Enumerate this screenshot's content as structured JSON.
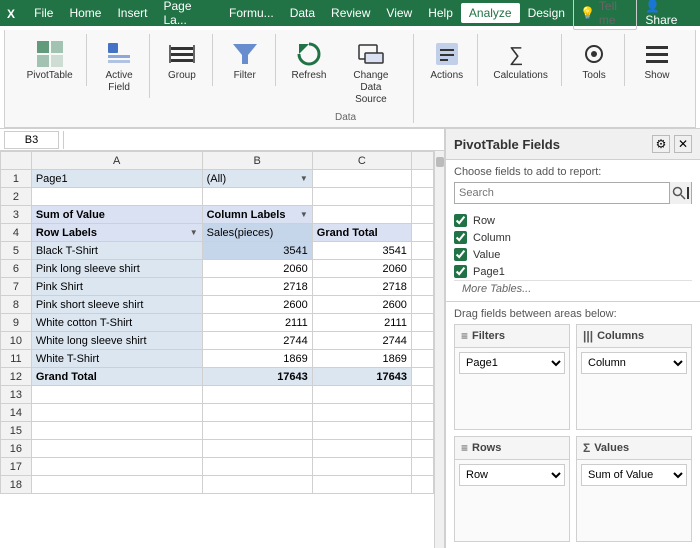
{
  "menuBar": {
    "items": [
      "File",
      "Home",
      "Insert",
      "Page Layout",
      "Formulas",
      "Data",
      "Review",
      "View",
      "Help",
      "Analyze",
      "Design"
    ],
    "activeItem": "Analyze",
    "tellMe": "Tell me",
    "share": "Share"
  },
  "ribbon": {
    "groups": [
      {
        "label": "",
        "buttons": [
          {
            "id": "pivottable",
            "label": "PivotTable",
            "icon": "⊞"
          }
        ]
      },
      {
        "label": "",
        "buttons": [
          {
            "id": "active-field",
            "label": "Active\nField",
            "icon": "⊡"
          }
        ]
      },
      {
        "label": "",
        "buttons": [
          {
            "id": "group",
            "label": "Group",
            "icon": "⊟"
          }
        ]
      },
      {
        "label": "",
        "buttons": [
          {
            "id": "filter",
            "label": "Filter",
            "icon": "⊿"
          }
        ]
      },
      {
        "label": "Data",
        "buttons": [
          {
            "id": "refresh",
            "label": "Refresh",
            "icon": "↻"
          },
          {
            "id": "change-data",
            "label": "Change Data\nSource",
            "icon": "⊞"
          }
        ]
      },
      {
        "label": "",
        "buttons": [
          {
            "id": "actions",
            "label": "Actions",
            "icon": "⊞"
          }
        ]
      },
      {
        "label": "",
        "buttons": [
          {
            "id": "calculations",
            "label": "Calculations",
            "icon": "∑"
          }
        ]
      },
      {
        "label": "",
        "buttons": [
          {
            "id": "tools",
            "label": "Tools",
            "icon": "⚙"
          }
        ]
      },
      {
        "label": "",
        "buttons": [
          {
            "id": "show",
            "label": "Show",
            "icon": "☰"
          }
        ]
      }
    ]
  },
  "spreadsheet": {
    "nameBox": "B3",
    "columns": [
      "A",
      "B",
      "C"
    ],
    "rows": [
      {
        "rowNum": "1",
        "cells": [
          {
            "value": "Page1",
            "style": "page-field"
          },
          {
            "value": "(All)",
            "style": "page-field dropdown"
          },
          {
            "value": "",
            "style": ""
          }
        ]
      },
      {
        "rowNum": "2",
        "cells": [
          {
            "value": "",
            "style": ""
          },
          {
            "value": "",
            "style": ""
          },
          {
            "value": "",
            "style": ""
          }
        ]
      },
      {
        "rowNum": "3",
        "cells": [
          {
            "value": "Sum of Value",
            "style": "pivot-value-header"
          },
          {
            "value": "Column Labels",
            "style": "pivot-header dropdown"
          },
          {
            "value": "",
            "style": ""
          }
        ]
      },
      {
        "rowNum": "4",
        "cells": [
          {
            "value": "Row Labels",
            "style": "pivot-header dropdown"
          },
          {
            "value": "Sales(pieces)",
            "style": "pivot-selected"
          },
          {
            "value": "Grand Total",
            "style": "pivot-header"
          }
        ]
      },
      {
        "rowNum": "5",
        "cells": [
          {
            "value": "Black T-Shirt",
            "style": "pivot-row-label"
          },
          {
            "value": "3541",
            "style": "pivot-data pivot-selected"
          },
          {
            "value": "3541",
            "style": "pivot-data"
          }
        ]
      },
      {
        "rowNum": "6",
        "cells": [
          {
            "value": "Pink long sleeve shirt",
            "style": "pivot-row-label"
          },
          {
            "value": "2060",
            "style": "pivot-data"
          },
          {
            "value": "2060",
            "style": "pivot-data"
          }
        ]
      },
      {
        "rowNum": "7",
        "cells": [
          {
            "value": "Pink Shirt",
            "style": "pivot-row-label"
          },
          {
            "value": "2718",
            "style": "pivot-data"
          },
          {
            "value": "2718",
            "style": "pivot-data"
          }
        ]
      },
      {
        "rowNum": "8",
        "cells": [
          {
            "value": "Pink short sleeve shirt",
            "style": "pivot-row-label"
          },
          {
            "value": "2600",
            "style": "pivot-data"
          },
          {
            "value": "2600",
            "style": "pivot-data"
          }
        ]
      },
      {
        "rowNum": "9",
        "cells": [
          {
            "value": "White cotton T-Shirt",
            "style": "pivot-row-label"
          },
          {
            "value": "2111",
            "style": "pivot-data"
          },
          {
            "value": "2111",
            "style": "pivot-data"
          }
        ]
      },
      {
        "rowNum": "10",
        "cells": [
          {
            "value": "White long sleeve shirt",
            "style": "pivot-row-label"
          },
          {
            "value": "2744",
            "style": "pivot-data"
          },
          {
            "value": "2744",
            "style": "pivot-data"
          }
        ]
      },
      {
        "rowNum": "11",
        "cells": [
          {
            "value": "White T-Shirt",
            "style": "pivot-row-label"
          },
          {
            "value": "1869",
            "style": "pivot-data"
          },
          {
            "value": "1869",
            "style": "pivot-data"
          }
        ]
      },
      {
        "rowNum": "12",
        "cells": [
          {
            "value": "Grand Total",
            "style": "pivot-grand"
          },
          {
            "value": "17643",
            "style": "pivot-data pivot-grand"
          },
          {
            "value": "17643",
            "style": "pivot-data pivot-grand"
          }
        ]
      },
      {
        "rowNum": "13",
        "cells": [
          {
            "value": "",
            "style": ""
          },
          {
            "value": "",
            "style": ""
          },
          {
            "value": "",
            "style": ""
          }
        ]
      },
      {
        "rowNum": "14",
        "cells": [
          {
            "value": "",
            "style": ""
          },
          {
            "value": "",
            "style": ""
          },
          {
            "value": "",
            "style": ""
          }
        ]
      },
      {
        "rowNum": "15",
        "cells": [
          {
            "value": "",
            "style": ""
          },
          {
            "value": "",
            "style": ""
          },
          {
            "value": "",
            "style": ""
          }
        ]
      },
      {
        "rowNum": "16",
        "cells": [
          {
            "value": "",
            "style": ""
          },
          {
            "value": "",
            "style": ""
          },
          {
            "value": "",
            "style": ""
          }
        ]
      },
      {
        "rowNum": "17",
        "cells": [
          {
            "value": "",
            "style": ""
          },
          {
            "value": "",
            "style": ""
          },
          {
            "value": "",
            "style": ""
          }
        ]
      },
      {
        "rowNum": "18",
        "cells": [
          {
            "value": "",
            "style": ""
          },
          {
            "value": "",
            "style": ""
          },
          {
            "value": "",
            "style": ""
          }
        ]
      }
    ]
  },
  "pivotPanel": {
    "title": "PivotTable Fields",
    "subtitle": "Choose fields to add to report:",
    "searchPlaceholder": "Search",
    "fields": [
      {
        "id": "row",
        "label": "Row",
        "checked": true
      },
      {
        "id": "column",
        "label": "Column",
        "checked": true
      },
      {
        "id": "value",
        "label": "Value",
        "checked": true
      },
      {
        "id": "page1",
        "label": "Page1",
        "checked": true
      }
    ],
    "moreTables": "More Tables...",
    "dragLabel": "Drag fields between areas below:",
    "areas": [
      {
        "id": "filters",
        "icon": "≡",
        "label": "Filters",
        "selected": "Page1",
        "options": [
          "Page1"
        ]
      },
      {
        "id": "columns",
        "icon": "|||",
        "label": "Columns",
        "selected": "Column",
        "options": [
          "Column"
        ]
      },
      {
        "id": "rows",
        "icon": "≡",
        "label": "Rows",
        "selected": "Row",
        "options": [
          "Row"
        ]
      },
      {
        "id": "values",
        "icon": "Σ",
        "label": "Values",
        "selected": "Sum of Value",
        "options": [
          "Sum of Value"
        ]
      }
    ]
  }
}
